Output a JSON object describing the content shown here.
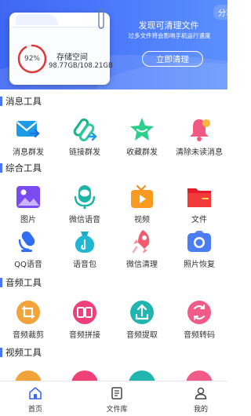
{
  "header": {
    "share_label": "分享",
    "storage": {
      "percent_label": "92%",
      "percent_value": 92,
      "title": "存储空间",
      "value": "98.77GB/108.21GB"
    },
    "clean": {
      "title": "发现可清理文件",
      "subtitle": "过多文件将会影响手机运行速度",
      "button": "立即清理"
    }
  },
  "sections": [
    {
      "title": "消息工具",
      "items": [
        {
          "label": "消息群发",
          "icon": "envelope-icon"
        },
        {
          "label": "链接群发",
          "icon": "paperclip-icon"
        },
        {
          "label": "收藏群发",
          "icon": "star-icon"
        },
        {
          "label": "清除未读消息",
          "icon": "bell-icon"
        }
      ]
    },
    {
      "title": "综合工具",
      "items": [
        {
          "label": "图片",
          "icon": "image-icon"
        },
        {
          "label": "微信语音",
          "icon": "wechat-voice-icon"
        },
        {
          "label": "视频",
          "icon": "video-icon"
        },
        {
          "label": "文件",
          "icon": "folder-icon"
        },
        {
          "label": "QQ语音",
          "icon": "microphone-icon"
        },
        {
          "label": "语音包",
          "icon": "voice-pack-icon"
        },
        {
          "label": "微信清理",
          "icon": "rocket-icon"
        },
        {
          "label": "照片恢复",
          "icon": "camera-icon"
        }
      ]
    },
    {
      "title": "音频工具",
      "items": [
        {
          "label": "音频裁剪",
          "icon": "audio-crop-icon"
        },
        {
          "label": "音频拼接",
          "icon": "audio-merge-icon"
        },
        {
          "label": "音频提取",
          "icon": "audio-extract-icon"
        },
        {
          "label": "音频转码",
          "icon": "audio-convert-icon"
        }
      ]
    },
    {
      "title": "视频工具",
      "items": []
    }
  ],
  "bottom_nav": [
    {
      "label": "首页",
      "icon": "home-icon"
    },
    {
      "label": "文件库",
      "icon": "document-icon"
    },
    {
      "label": "我的",
      "icon": "user-icon"
    }
  ],
  "colors": {
    "header_start": "#3f67f5",
    "header_end": "#5b8ffd",
    "section_accent": "#4b74f7",
    "gauge_red": "#e0383a"
  }
}
